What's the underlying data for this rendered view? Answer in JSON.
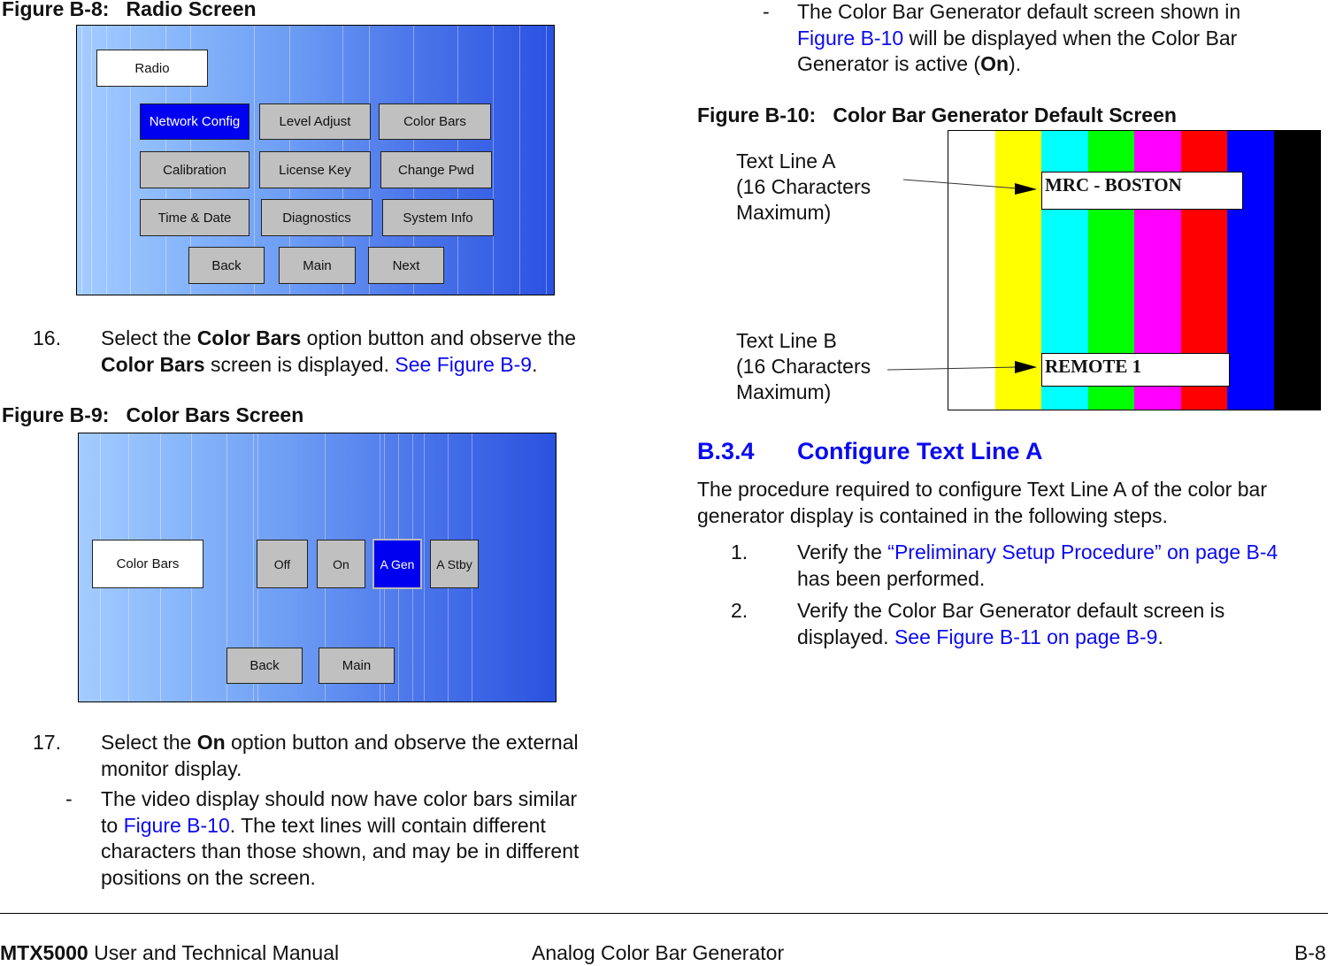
{
  "figure_b8": {
    "title": "Figure B-8:   Radio Screen",
    "screen_label": "Radio",
    "buttons": [
      {
        "label": "Network Config",
        "selected": true
      },
      {
        "label": "Level Adjust",
        "selected": false
      },
      {
        "label": "Color Bars",
        "selected": false
      },
      {
        "label": "Calibration",
        "selected": false
      },
      {
        "label": "License Key",
        "selected": false
      },
      {
        "label": "Change Pwd",
        "selected": false
      },
      {
        "label": "Time & Date",
        "selected": false
      },
      {
        "label": "Diagnostics",
        "selected": false
      },
      {
        "label": "System Info",
        "selected": false
      }
    ],
    "nav": {
      "back": "Back",
      "main": "Main",
      "next": "Next"
    }
  },
  "step16": {
    "number": "16.",
    "t1": "Select the ",
    "b1": "Color Bars",
    "t2": " option button and observe the",
    "b2": "Color Bars",
    "t3": " screen is displayed.  ",
    "link": "See Figure B-9",
    "t4": "."
  },
  "figure_b9": {
    "title": "Figure B-9:   Color Bars Screen",
    "screen_label": "Color Bars",
    "buttons": [
      {
        "label": "Off",
        "selected": false
      },
      {
        "label": "On",
        "selected": false
      },
      {
        "label": "A Gen",
        "selected": true
      },
      {
        "label": "A Stby",
        "selected": false
      }
    ],
    "nav": {
      "back": "Back",
      "main": "Main"
    }
  },
  "step17": {
    "number": "17.",
    "t1": "Select the ",
    "b1": "On",
    "t2": " option button and observe the external",
    "t3": "monitor display.",
    "sub": {
      "dash": "-",
      "t1": "The video display should now have color bars similar",
      "t2": "to ",
      "link": "Figure B-10",
      "t3": ".  The text lines will contain different",
      "t4": "characters than those shown, and may be in different",
      "t5": "positions on the screen."
    }
  },
  "right_intro": {
    "dash": "-",
    "t1": "The Color Bar Generator default screen shown in",
    "link": "Figure B-10",
    "t2": " will be displayed when the Color Bar",
    "t3": "Generator is active (",
    "b1": "On",
    "t4": ")."
  },
  "figure_b10": {
    "title": "Figure B-10:   Color Bar Generator Default Screen",
    "bar_colors": [
      "#ffffff",
      "#ffff00",
      "#00ffff",
      "#00ff00",
      "#ff00ff",
      "#ff0000",
      "#0000ff",
      "#000000"
    ],
    "text_line_a": "MRC - BOSTON",
    "text_line_b": "REMOTE 1",
    "callout_a": [
      "Text Line A",
      "(16 Characters",
      "Maximum)"
    ],
    "callout_b": [
      "Text Line B",
      "(16 Characters",
      "Maximum)"
    ]
  },
  "section": {
    "number": "B.3.4",
    "title": "Configure Text Line A",
    "intro1": "The procedure required to configure Text Line A of the color bar",
    "intro2": "generator display is contained in the following steps.",
    "steps": [
      {
        "number": "1.",
        "t1": "Verify the ",
        "link": "“Preliminary Setup Procedure” on page B-4",
        "t2": "has been performed."
      },
      {
        "number": "2.",
        "t1": "Verify the Color Bar Generator default screen is",
        "t2": "displayed.  ",
        "link": "See Figure B-11 on page B-9",
        "t3": "."
      }
    ]
  },
  "footer": {
    "product": "MTX5000",
    "manual": " User and Technical Manual",
    "chapter": "Analog Color Bar Generator",
    "page": "B-8"
  }
}
